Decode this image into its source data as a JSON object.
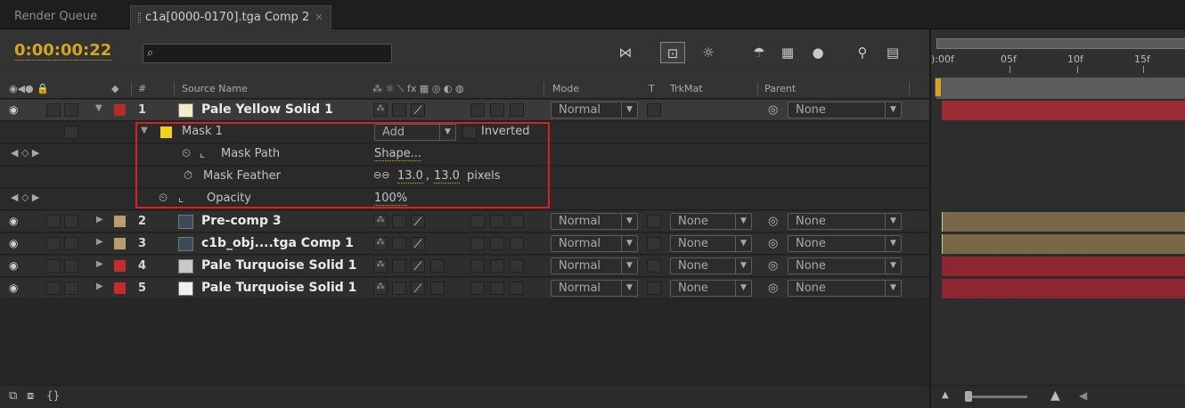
{
  "tabs": [
    {
      "label": "Render Queue"
    },
    {
      "label": "c1a[0000-0170].tga Comp 2"
    }
  ],
  "header": {
    "timecode": "0:00:00:22",
    "search_placeholder": ""
  },
  "columns": {
    "num": "#",
    "source_name": "Source Name",
    "mode": "Mode",
    "t": "T",
    "trkmat": "TrkMat",
    "parent": "Parent"
  },
  "layers": [
    {
      "num": "1",
      "name": "Pale Yellow Solid 1",
      "label_color": "#b52a2a",
      "mode": "Normal",
      "trkmat": "",
      "parent": "None"
    },
    {
      "num": "2",
      "name": "Pre-comp 3",
      "label_color": "#b89d6e",
      "mode": "Normal",
      "trkmat": "None",
      "parent": "None"
    },
    {
      "num": "3",
      "name": "c1b_obj....tga Comp 1",
      "label_color": "#b89d6e",
      "mode": "Normal",
      "trkmat": "None",
      "parent": "None"
    },
    {
      "num": "4",
      "name": "Pale Turquoise Solid 1",
      "label_color": "#c42d2d",
      "mode": "Normal",
      "trkmat": "None",
      "parent": "None"
    },
    {
      "num": "5",
      "name": "Pale Turquoise Solid 1",
      "label_color": "#c42d2d",
      "mode": "Normal",
      "trkmat": "None",
      "parent": "None"
    }
  ],
  "mask": {
    "name": "Mask 1",
    "mode": "Add",
    "inverted_label": "Inverted",
    "path_label": "Mask Path",
    "path_value": "Shape...",
    "feather_label": "Mask Feather",
    "feather_x": "13.0",
    "feather_sep": ",",
    "feather_y": "13.0",
    "feather_unit": "pixels",
    "opacity_label": "Opacity",
    "opacity_value": "100%"
  },
  "timeline": {
    "ticks": [
      "):00f",
      "05f",
      "10f",
      "15f"
    ]
  },
  "colors": {
    "timecode": "#d4a524",
    "value_orange": "#d4a524",
    "highlight_box": "#d82020",
    "bar_red": "#9b2a33",
    "bar_tan": "#7a6748"
  }
}
